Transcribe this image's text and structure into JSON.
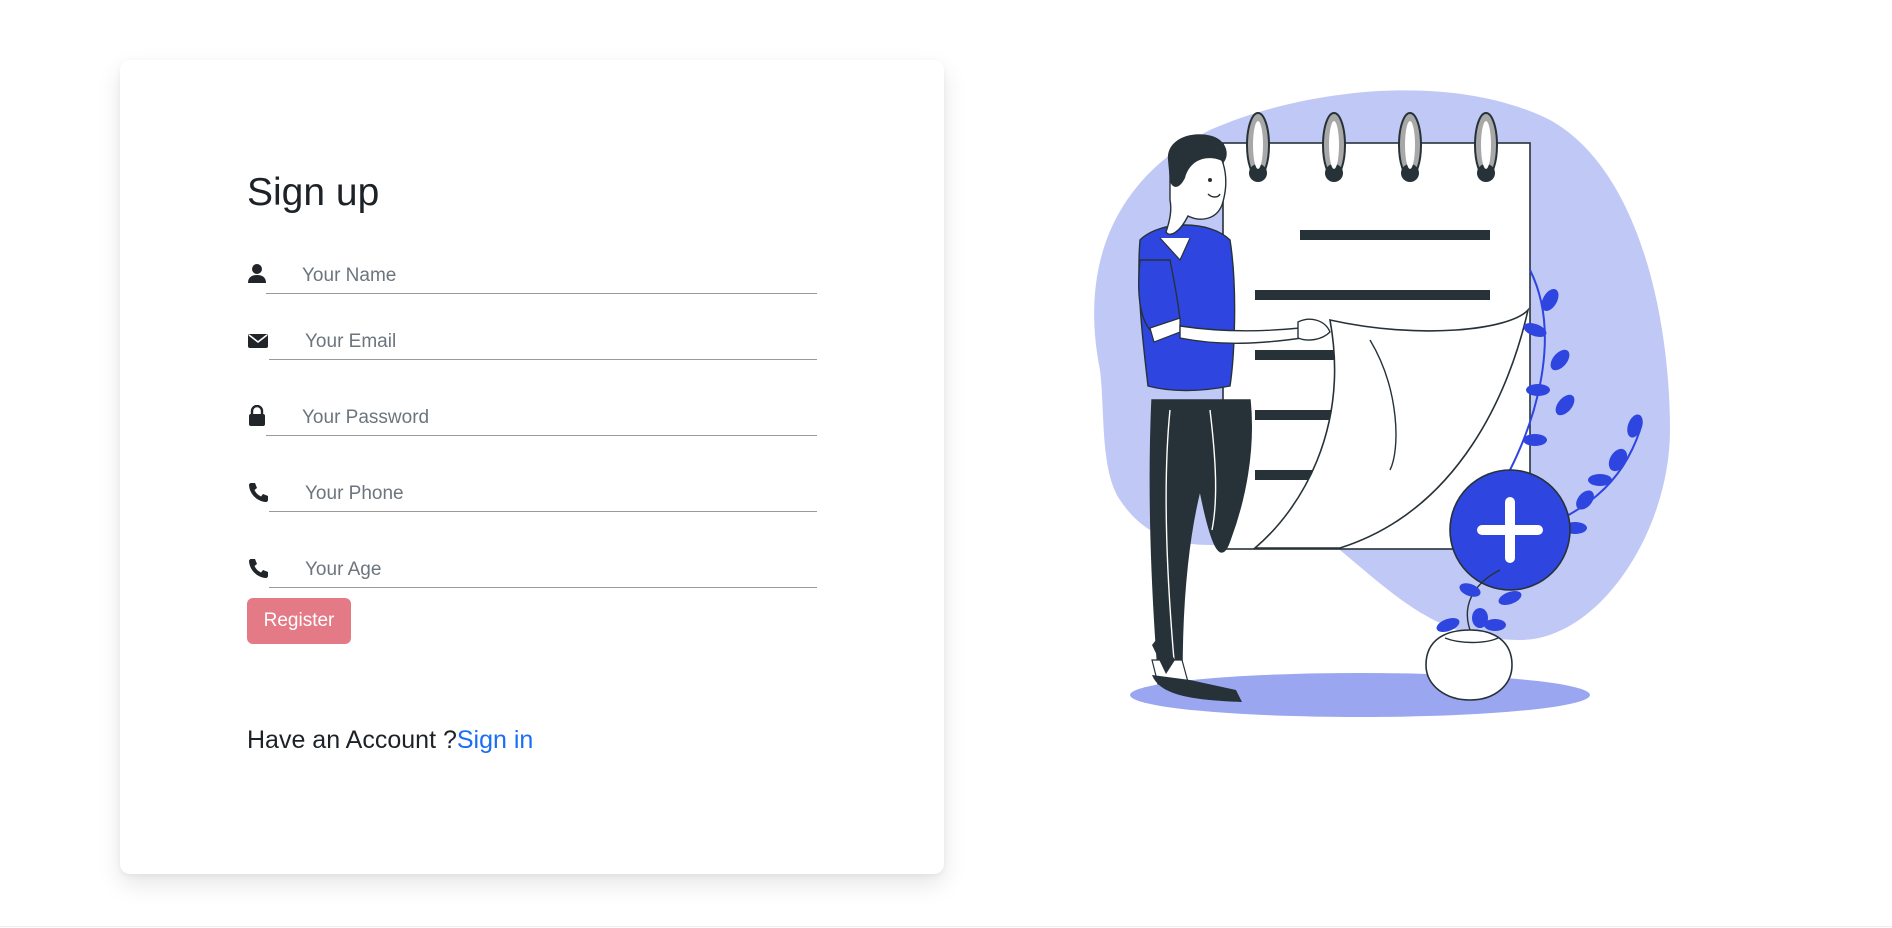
{
  "form": {
    "title": "Sign up",
    "fields": [
      {
        "icon": "user-icon",
        "placeholder": "Your Name",
        "value": ""
      },
      {
        "icon": "envelope-icon",
        "placeholder": "Your Email",
        "value": ""
      },
      {
        "icon": "lock-icon",
        "placeholder": "Your Password",
        "value": ""
      },
      {
        "icon": "phone-icon",
        "placeholder": "Your Phone",
        "value": ""
      },
      {
        "icon": "phone-icon",
        "placeholder": "Your Age",
        "value": ""
      }
    ],
    "register_label": "Register",
    "account_prompt": "Have an Account ?",
    "signin_label": "Sign in"
  },
  "colors": {
    "register_button": "#e47a85",
    "link": "#1a6ef5",
    "illustration_blob": "#c0c8f5",
    "illustration_accent": "#2e45e0",
    "illustration_dark": "#263238"
  }
}
